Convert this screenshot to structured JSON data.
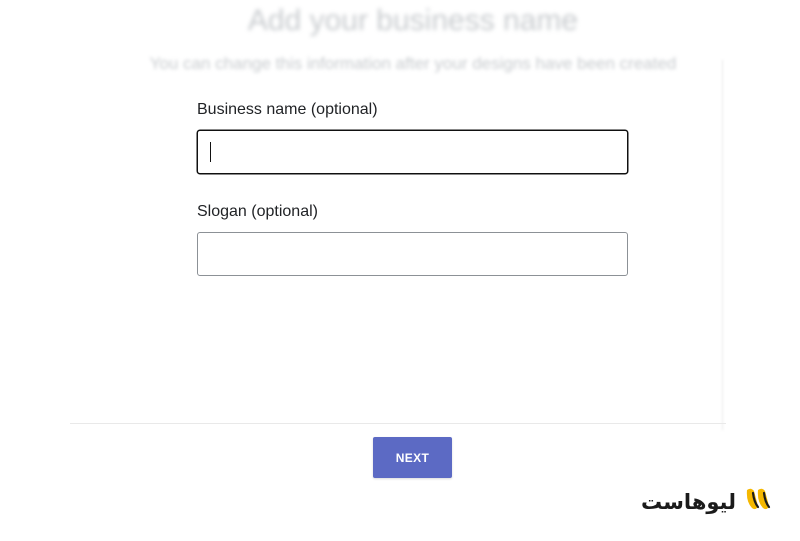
{
  "header": {
    "title": "Add your business name",
    "subtitle": "You can change this information after your designs have been created"
  },
  "form": {
    "business_name": {
      "label": "Business name (optional)",
      "value": "",
      "placeholder": ""
    },
    "slogan": {
      "label": "Slogan (optional)",
      "value": "",
      "placeholder": ""
    }
  },
  "actions": {
    "next_label": "NEXT"
  },
  "watermark": {
    "text": "لیوهاست"
  },
  "colors": {
    "accent": "#5c6ac4",
    "text": "#212326",
    "logo_yellow": "#f5b800"
  },
  "icons": {
    "watermark_logo": "liuhost-logo-icon"
  }
}
